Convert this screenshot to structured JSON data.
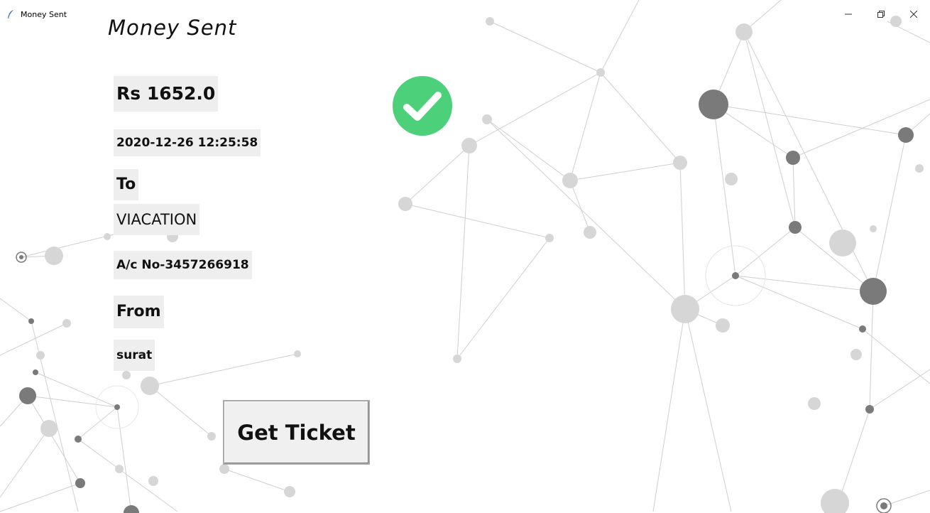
{
  "window": {
    "title": "Money Sent",
    "icon": "feather-icon",
    "controls": [
      "minimize-icon",
      "restore-icon",
      "close-icon"
    ]
  },
  "page": {
    "heading": "Money Sent"
  },
  "transaction": {
    "amount": "Rs 1652.0",
    "datetime": "2020-12-26 12:25:58",
    "to_label": "To",
    "recipient": "VIACATION",
    "account": "A/c No-3457266918",
    "from_label": "From",
    "sender": "surat"
  },
  "status": {
    "icon": "check-circle-icon",
    "color": "#4cd07a"
  },
  "actions": {
    "get_ticket_label": "Get Ticket"
  }
}
